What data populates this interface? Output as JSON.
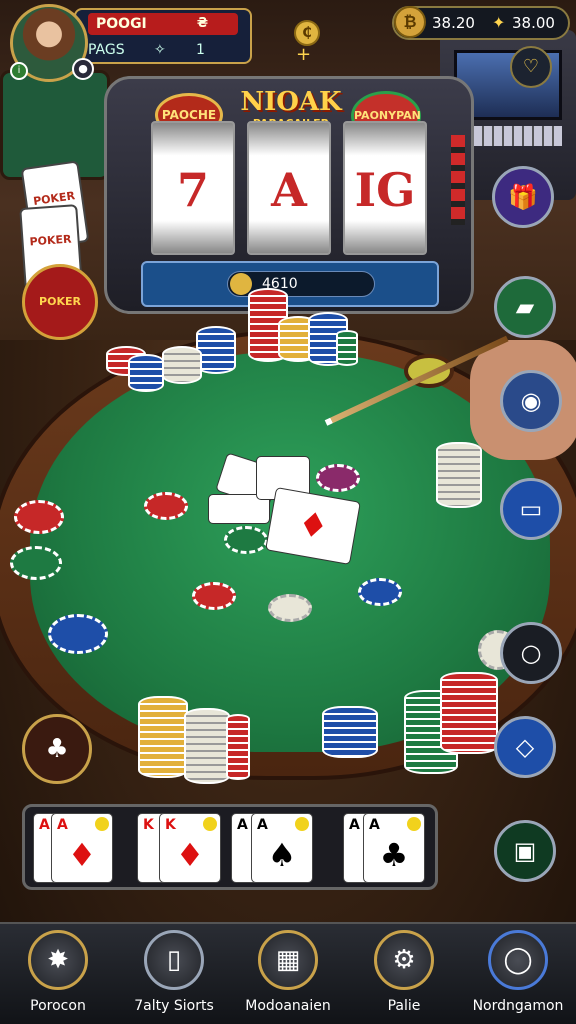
{
  "player": {
    "name": "POOGI",
    "count": "₴",
    "sub_label": "PAGS",
    "sub_icon": "✧",
    "level": "1",
    "coin_symbol": "₵",
    "plus": "+"
  },
  "currency": {
    "icon": "₿",
    "amount": "38.20",
    "spark": "✦",
    "amount2": "38.00"
  },
  "slot": {
    "title": "NIOAK",
    "subtitle": "PARACAILER",
    "left_logo": "PAOCHE",
    "right_logo": "PAONYPAN",
    "reels": [
      "7",
      "A",
      "IG"
    ],
    "credit": "4610"
  },
  "left_cards": [
    "POKER",
    "POKER",
    "POKER"
  ],
  "hand_cards": [
    {
      "rank": "A",
      "suit": "♦",
      "color": "red"
    },
    {
      "rank": "K",
      "suit": "♦",
      "color": "red"
    },
    {
      "rank": "A",
      "suit": "♠",
      "color": "black"
    },
    {
      "rank": "A",
      "suit": "♣",
      "color": "black"
    }
  ],
  "table_cards": [
    {
      "suit": "♠"
    },
    {
      "suit": "♣"
    },
    {
      "suit": "♦"
    }
  ],
  "right_buttons": [
    {
      "name": "heart-icon",
      "glyph": "♡",
      "bg": "#1c2330"
    },
    {
      "name": "gift-icon",
      "glyph": "🎁",
      "bg": "#3d2a80"
    },
    {
      "name": "gold-bar-icon",
      "glyph": "▰",
      "bg": "#1e6a3a"
    },
    {
      "name": "shield-icon",
      "glyph": "◉",
      "bg": "#2a4a8a"
    },
    {
      "name": "ticket-icon",
      "glyph": "▭",
      "bg": "#1e4ea8"
    },
    {
      "name": "ring-icon",
      "glyph": "○",
      "bg": "#1a1d24"
    },
    {
      "name": "tag-icon",
      "glyph": "◇",
      "bg": "#1e4ea8"
    },
    {
      "name": "trophy-icon",
      "glyph": "▣",
      "bg": "#0f3a22"
    }
  ],
  "nav": [
    {
      "label": "Porocon",
      "glyph": "✸",
      "accent": "#c9a24a"
    },
    {
      "label": "7alty Siorts",
      "glyph": "▯",
      "accent": "#9aa6b8"
    },
    {
      "label": "Modoanaien",
      "glyph": "▦",
      "accent": "#c9a24a"
    },
    {
      "label": "Palie",
      "glyph": "⚙",
      "accent": "#c9a24a"
    },
    {
      "label": "Nordngamon",
      "glyph": "◯",
      "accent": "#4a7ad8"
    }
  ]
}
